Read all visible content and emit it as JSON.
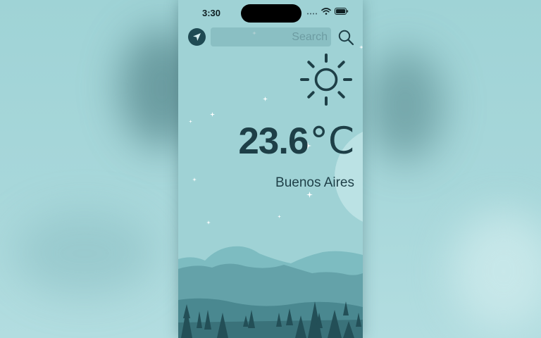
{
  "status_bar": {
    "time": "3:30",
    "icons": [
      "cellular-signal-icon",
      "wifi-icon",
      "battery-icon"
    ]
  },
  "search": {
    "placeholder": "Search",
    "value": "",
    "button_icon": "magnifying-glass-icon"
  },
  "location_button": {
    "icon": "location-arrow-icon"
  },
  "weather": {
    "condition_icon": "sun-icon",
    "temperature_value": "23.6",
    "temperature_unit": "°C",
    "city": "Buenos Aires"
  },
  "colors": {
    "background": "#9fd2d5",
    "text_primary": "#1e3f47",
    "mountains_far": "#78b9be",
    "mountains_mid": "#5f9ea5",
    "mountains_near": "#3f7a82",
    "trees": "#234f57"
  }
}
